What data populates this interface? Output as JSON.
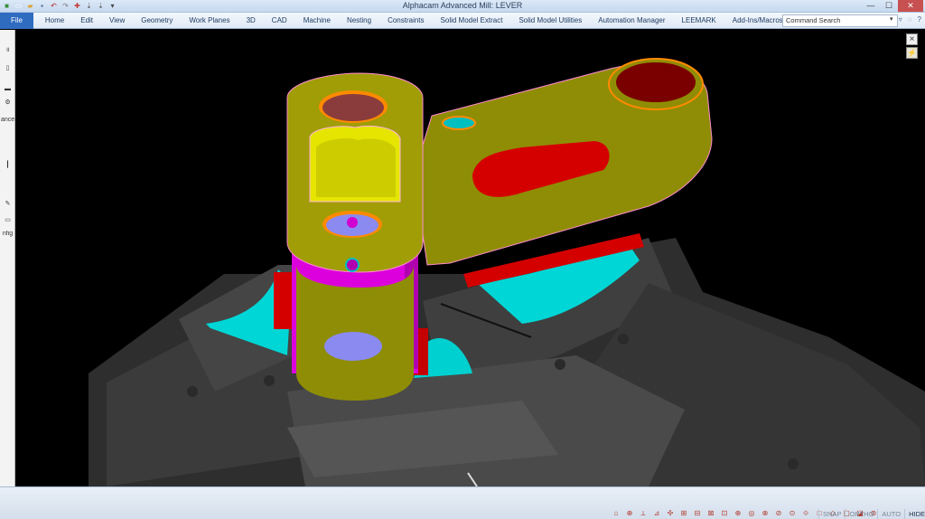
{
  "window": {
    "title": "Alphacam Advanced Mill: LEVER",
    "controls": {
      "minimize": "—",
      "maximize": "☐",
      "close": "✕"
    }
  },
  "quick_access": [
    {
      "name": "app-icon",
      "glyph": "■",
      "color": "#3a8d3a"
    },
    {
      "name": "new-icon",
      "glyph": "▭",
      "color": "#ffffff"
    },
    {
      "name": "open-icon",
      "glyph": "▰",
      "color": "#d9a235"
    },
    {
      "name": "save-icon",
      "glyph": "▪",
      "color": "#3f5e98"
    },
    {
      "name": "undo-icon",
      "glyph": "↶",
      "color": "#b42c2c"
    },
    {
      "name": "redo-icon",
      "glyph": "↷",
      "color": "#7a7a7a"
    },
    {
      "name": "tool-icon",
      "glyph": "✚",
      "color": "#c63a3a"
    },
    {
      "name": "pin-icon",
      "glyph": "⇣",
      "color": "#555555"
    },
    {
      "name": "flag-icon",
      "glyph": "⇣",
      "color": "#555555"
    },
    {
      "name": "customize-icon",
      "glyph": "▾",
      "color": "#444444"
    }
  ],
  "ribbon": {
    "tabs": [
      "File",
      "Home",
      "Edit",
      "View",
      "Geometry",
      "Work Planes",
      "3D",
      "CAD",
      "Machine",
      "Nesting",
      "Constraints",
      "Solid Model Extract",
      "Solid Model Utilities",
      "Automation Manager",
      "LEEMARK",
      "Add-Ins/Macros"
    ],
    "search_placeholder": "Command Search",
    "search_dropdown": "▾",
    "right_icons": [
      "▿",
      "◌",
      "?"
    ]
  },
  "left_panel": {
    "items": [
      {
        "name": "panel-pause-icon",
        "text": "॥"
      },
      {
        "name": "panel-slider-top",
        "text": "▯"
      },
      {
        "name": "panel-stop-icon",
        "text": "▬"
      },
      {
        "name": "panel-feed-icon",
        "text": "⚙"
      },
      {
        "name": "panel-label-tolerance",
        "text": "ance"
      },
      {
        "name": "panel-slider",
        "text": "┃"
      },
      {
        "name": "panel-pencil-icon",
        "text": "✎"
      },
      {
        "name": "panel-box-icon",
        "text": "▭"
      },
      {
        "name": "panel-label-config",
        "text": "nfig"
      }
    ]
  },
  "viewport": {
    "close_label": "×",
    "view_icon": "⚡"
  },
  "statusbar": {
    "tool_icons": [
      "⌂",
      "⊕",
      "⟂",
      "⊿",
      "✣",
      "⊞",
      "⊟",
      "⊠",
      "⊡",
      "⊕",
      "◎",
      "⊗",
      "⊘",
      "⊙",
      "⟐",
      "□",
      "◇",
      "▢",
      "◪",
      "⊛"
    ],
    "toggles": [
      {
        "label": "SNAP",
        "on": false
      },
      {
        "label": "ORTHO",
        "on": false
      },
      {
        "label": "AUTO",
        "on": false
      },
      {
        "label": "HIDE",
        "on": true
      }
    ]
  },
  "colors": {
    "part_olive": "#8f8d05",
    "part_magenta": "#dc00dc",
    "bore_lavender": "#8a8af0",
    "slot_red": "#d00000",
    "fixture_cyan": "#00d8d8",
    "fixture_gray": "#3a3a3a",
    "highlight_yellow": "#f4f400",
    "edge_orange": "#ff8a00"
  }
}
